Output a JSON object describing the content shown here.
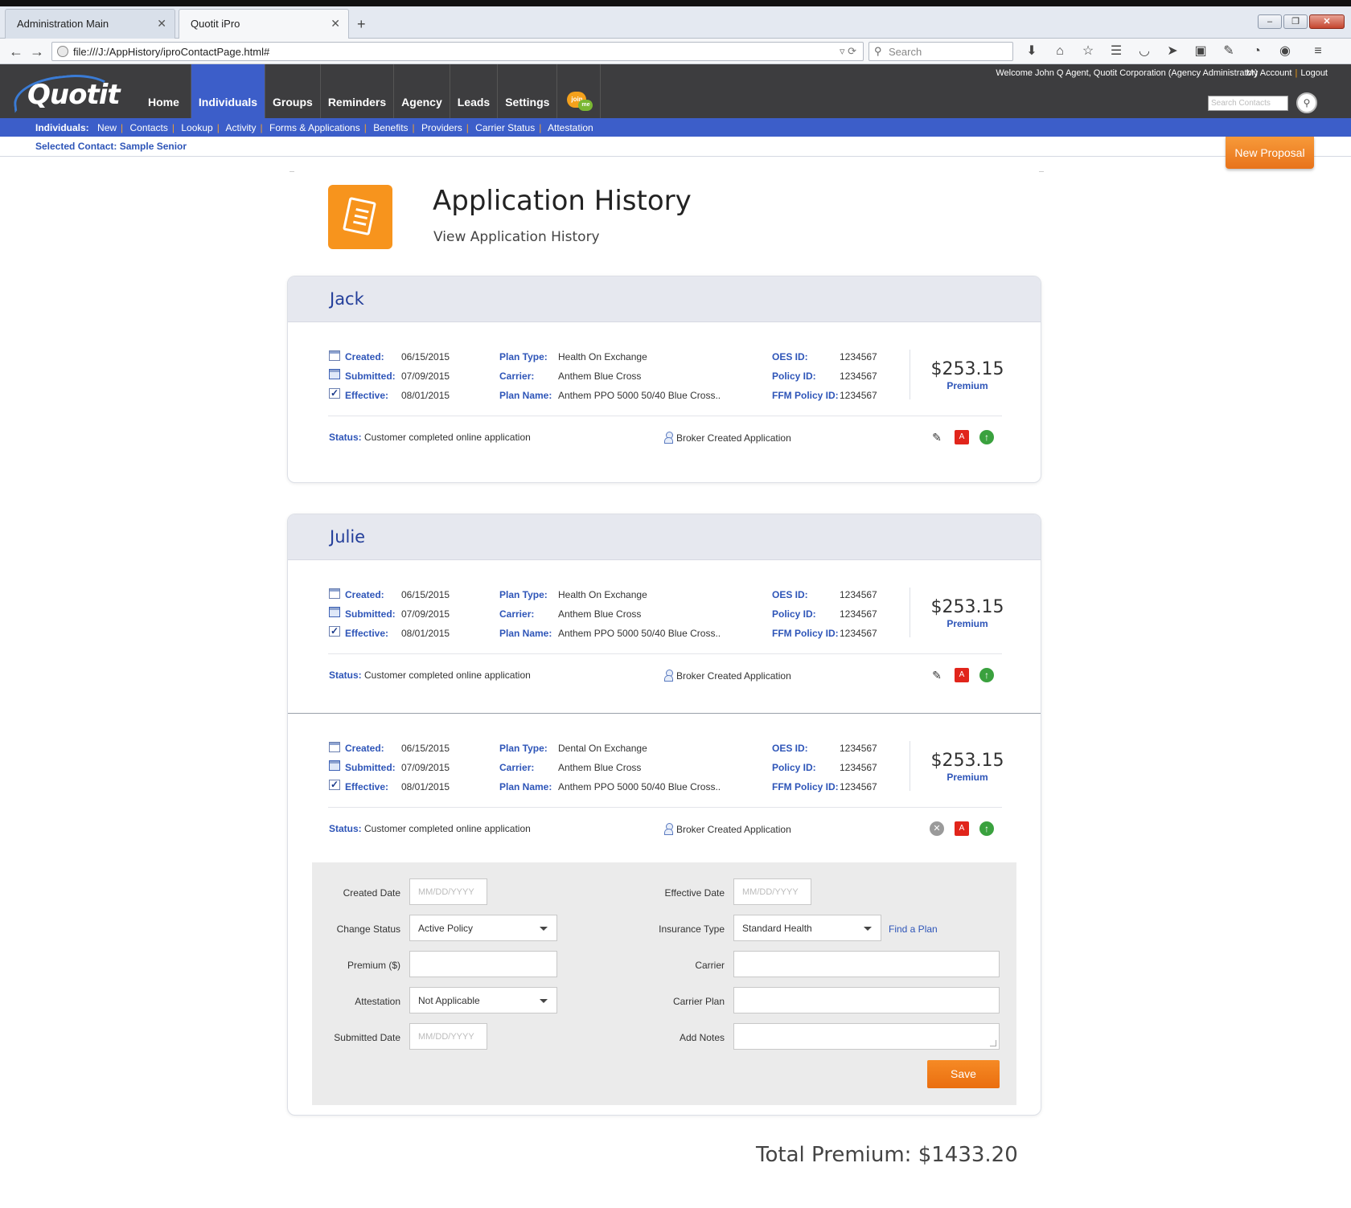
{
  "browser": {
    "tabs": [
      {
        "label": "Administration Main"
      },
      {
        "label": "Quotit iPro"
      }
    ],
    "url": "file:///J:/AppHistory/iproContactPage.html#",
    "search_placeholder": "Search"
  },
  "header": {
    "logo_text": "Quotit",
    "nav": [
      "Home",
      "Individuals",
      "Groups",
      "Reminders",
      "Agency",
      "Leads",
      "Settings"
    ],
    "joinme": {
      "top": "join",
      "bottom": "me"
    },
    "welcome": "Welcome John Q Agent, Quotit Corporation (Agency Administrator)",
    "my_account": "My Account",
    "logout": "Logout",
    "search_placeholder": "Search Contacts"
  },
  "subnav": {
    "label": "Individuals:",
    "links": [
      "New",
      "Contacts",
      "Lookup",
      "Activity",
      "Forms & Applications",
      "Benefits",
      "Providers",
      "Carrier Status",
      "Attestation"
    ]
  },
  "selected_contact": "Selected Contact: Sample Senior",
  "new_proposal": "New Proposal",
  "page": {
    "title": "Application History",
    "subtitle": "View Application History"
  },
  "labels": {
    "created": "Created:",
    "submitted": "Submitted:",
    "effective": "Effective:",
    "plan_type": "Plan Type:",
    "carrier": "Carrier:",
    "plan_name": "Plan Name:",
    "oes_id": "OES ID:",
    "policy_id": "Policy ID:",
    "ffm_policy_id": "FFM Policy ID:",
    "premium": "Premium",
    "status": "Status:"
  },
  "people": [
    {
      "name": "Jack",
      "apps": [
        {
          "created": "06/15/2015",
          "submitted": "07/09/2015",
          "effective": "08/01/2015",
          "plan_type": "Health On Exchange",
          "carrier": "Anthem Blue Cross",
          "plan_name": "Anthem PPO 5000 50/40 Blue Cross..",
          "oes_id": "1234567",
          "policy_id": "1234567",
          "ffm_policy_id": "1234567",
          "price": "$253.15",
          "status": "Customer completed online application",
          "broker": "Broker Created Application"
        }
      ]
    },
    {
      "name": "Julie",
      "apps": [
        {
          "created": "06/15/2015",
          "submitted": "07/09/2015",
          "effective": "08/01/2015",
          "plan_type": "Health On Exchange",
          "carrier": "Anthem Blue Cross",
          "plan_name": "Anthem PPO 5000 50/40 Blue Cross..",
          "oes_id": "1234567",
          "policy_id": "1234567",
          "ffm_policy_id": "1234567",
          "price": "$253.15",
          "status": "Customer completed online application",
          "broker": "Broker Created Application"
        },
        {
          "created": "06/15/2015",
          "submitted": "07/09/2015",
          "effective": "08/01/2015",
          "plan_type": "Dental On Exchange",
          "carrier": "Anthem Blue Cross",
          "plan_name": "Anthem PPO 5000 50/40 Blue Cross..",
          "oes_id": "1234567",
          "policy_id": "1234567",
          "ffm_policy_id": "1234567",
          "price": "$253.15",
          "status": "Customer completed online application",
          "broker": "Broker Created Application"
        }
      ]
    }
  ],
  "form": {
    "created_date_label": "Created Date",
    "change_status_label": "Change Status",
    "premium_label": "Premium ($)",
    "attestation_label": "Attestation",
    "submitted_date_label": "Submitted Date",
    "effective_date_label": "Effective Date",
    "insurance_type_label": "Insurance Type",
    "carrier_label": "Carrier",
    "carrier_plan_label": "Carrier Plan",
    "add_notes_label": "Add Notes",
    "date_placeholder": "MM/DD/YYYY",
    "change_status_value": "Active Policy",
    "attestation_value": "Not Applicable",
    "insurance_type_value": "Standard Health",
    "find_plan": "Find a Plan",
    "premium_value": "",
    "carrier_value": "",
    "carrier_plan_value": "",
    "notes_value": "",
    "save": "Save"
  },
  "total_premium": "Total Premium: $1433.20",
  "colors": {
    "brand_blue": "#3c5ec9",
    "header_dark": "#3d3d3f",
    "accent_orange": "#f7941d",
    "label_blue": "#2e55b8"
  }
}
